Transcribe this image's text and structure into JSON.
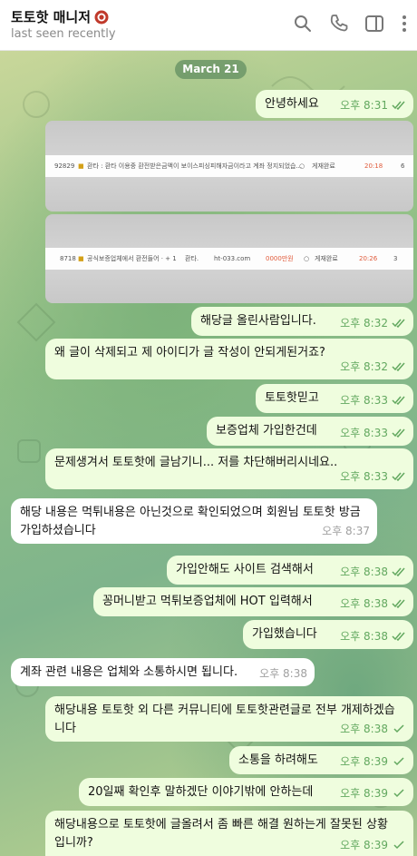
{
  "header": {
    "title": "토토핫 매니저",
    "subtitle": "last seen recently",
    "icons": [
      "search-icon",
      "phone-icon",
      "sidebar-icon",
      "more-icon"
    ]
  },
  "date_label": "March 21",
  "images": [
    {
      "row_number": "92829",
      "text": "환타 : 환타 이용중 환전받은금액이 보이스피싱피해자금이라고 계좌 정지되었습...",
      "status": "게재완료",
      "time": "20:18",
      "count": "6"
    },
    {
      "row_number": "8718",
      "text": "공식보증업체에서 환전들어 · + 1",
      "name": "환타.",
      "site": "ht-033.com",
      "amount": "0000만원",
      "status": "게재완료",
      "time": "20:26",
      "count": "3"
    }
  ],
  "messages": [
    {
      "dir": "out",
      "text": "안녕하세요",
      "time": "오후 8:31",
      "read": true
    },
    {
      "dir": "out",
      "text": "해당글 올린사람입니다.",
      "time": "오후 8:32",
      "read": true
    },
    {
      "dir": "out",
      "text": "왜 글이 삭제되고 제 아이디가 글 작성이 안되게된거죠?",
      "time": "오후 8:32",
      "read": true
    },
    {
      "dir": "out",
      "text": "토토핫믿고",
      "time": "오후 8:33",
      "read": true
    },
    {
      "dir": "out",
      "text": "보증업체 가입한건데",
      "time": "오후 8:33",
      "read": true
    },
    {
      "dir": "out",
      "text": "문제생겨서 토토핫에 글남기니... 저를 차단해버리시네요..",
      "time": "오후 8:33",
      "read": true
    },
    {
      "dir": "in",
      "text": "해당 내용은 먹튀내용은 아닌것으로 확인되었으며 회원님 토토핫 방금 가입하셨습니다",
      "time": "오후 8:37"
    },
    {
      "dir": "out",
      "text": "가입안해도 사이트 검색해서",
      "time": "오후 8:38",
      "read": true
    },
    {
      "dir": "out",
      "text": "꽁머니받고 먹튀보증업체에 HOT 입력해서",
      "time": "오후 8:38",
      "read": true
    },
    {
      "dir": "out",
      "text": "가입했습니다",
      "time": "오후 8:38",
      "read": true
    },
    {
      "dir": "in",
      "text": "계좌 관련 내용은 업체와 소통하시면 됩니다.",
      "time": "오후 8:38"
    },
    {
      "dir": "out",
      "text": "해당내용 토토핫 외 다른 커뮤니티에 토토핫관련글로 전부 개제하겠습니다",
      "time": "오후 8:38",
      "read": false
    },
    {
      "dir": "out",
      "text": "소통을 하려해도",
      "time": "오후 8:39",
      "read": false
    },
    {
      "dir": "out",
      "text": "20일째 확인후 말하겠단 이야기밖에 안하는데",
      "time": "오후 8:39",
      "read": false
    },
    {
      "dir": "out",
      "text": "해당내용으로 토토핫에 글올려서 좀 빠른 해결 원하는게 잘못된 상황입니까?",
      "time": "오후 8:39",
      "read": false
    }
  ],
  "colors": {
    "outgoing_bubble": "#effdde",
    "incoming_bubble": "#ffffff",
    "check": "#62a85f",
    "verified_badge": "#c0392b"
  }
}
